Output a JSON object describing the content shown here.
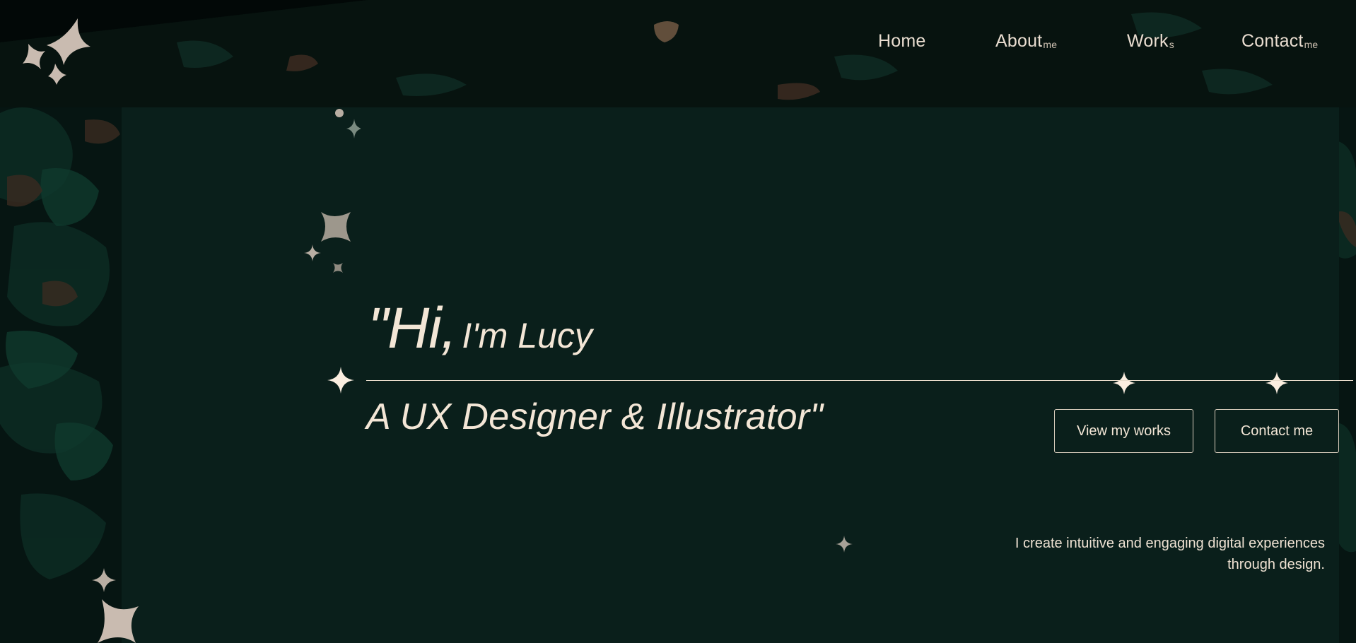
{
  "nav": {
    "items": [
      {
        "label": "Home",
        "suffix": ""
      },
      {
        "label": "About",
        "suffix": "me"
      },
      {
        "label": "Work",
        "suffix": "s"
      },
      {
        "label": "Contact",
        "suffix": "me"
      }
    ]
  },
  "hero": {
    "greeting_big": "\"Hi,",
    "greeting_small": "I'm Lucy",
    "subtitle": "A UX Designer & Illustrator\"",
    "tagline_line1": "I create intuitive and engaging digital experiences",
    "tagline_line2": "through design."
  },
  "actions": {
    "view_works": "View my works",
    "contact_me": "Contact me"
  },
  "colors": {
    "background": "#061a15",
    "panel": "#0a1f1b",
    "cream": "#f3e6d6",
    "muted_star": "#b9aea3"
  },
  "icons": {
    "logo": "sparkle-logo-icon",
    "decor": "sparkle-icon"
  }
}
